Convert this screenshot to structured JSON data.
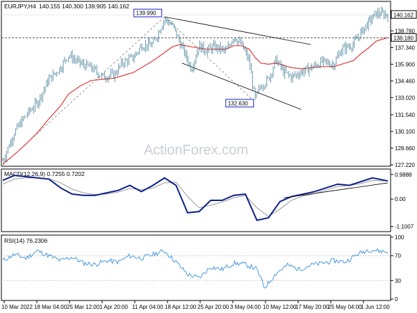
{
  "header": {
    "symbol": "EURJPY,H4",
    "ohlc": "140.155 140.300 139.905 140.162"
  },
  "watermark": "ActionForex.com",
  "colors": {
    "candle": "#2f6f8a",
    "ma": "#e03a3a",
    "trend": "#000000",
    "macd_hist": "#0b1f8a",
    "macd_signal": "#9a9a9a",
    "rsi": "#3a8fd8",
    "label_border": "#1a1ad0",
    "grid": "#c8c8c8"
  },
  "chart_data": [
    {
      "type": "line",
      "name": "price",
      "title": "EURJPY,H4",
      "ylim": [
        127.22,
        141.2
      ],
      "y_ticks": [
        127.22,
        128.66,
        130.1,
        131.54,
        133.02,
        134.46,
        135.9,
        137.34,
        138.78
      ],
      "y_tick_labels": [
        "127.220",
        "128.660",
        "130.100",
        "131.540",
        "133.020",
        "134.460",
        "135.900",
        "137.340",
        "138.780"
      ],
      "x_ticks": [
        "10 Mar 2022",
        "18 Mar 04:00",
        "25 Mar 12:00",
        "1 Apr 20:00",
        "11 Apr 04:00",
        "18 Apr 12:00",
        "25 Apr 20:00",
        "3 May 04:00",
        "10 May 12:00",
        "17 May 20:00",
        "25 May 04:00",
        "1 Jun 12:00"
      ],
      "current_price": 140.162,
      "current_price_label": "140.162",
      "hline": 138.18,
      "hline_label": "138.180",
      "annotations": [
        {
          "text": "139.990",
          "x": 0.42,
          "y": 139.99
        },
        {
          "text": "132.630",
          "x": 0.655,
          "y": 132.63
        }
      ],
      "x": [
        0,
        0.03,
        0.06,
        0.09,
        0.12,
        0.15,
        0.17,
        0.2,
        0.23,
        0.26,
        0.29,
        0.31,
        0.34,
        0.36,
        0.39,
        0.42,
        0.44,
        0.46,
        0.49,
        0.51,
        0.53,
        0.55,
        0.58,
        0.6,
        0.62,
        0.64,
        0.655,
        0.67,
        0.69,
        0.71,
        0.73,
        0.75,
        0.78,
        0.8,
        0.83,
        0.86,
        0.88,
        0.91,
        0.93,
        0.95,
        0.97,
        1.0
      ],
      "values": [
        127.6,
        130.0,
        131.5,
        132.6,
        134.6,
        135.6,
        136.7,
        136.0,
        135.6,
        134.8,
        135.0,
        136.0,
        136.5,
        137.5,
        137.6,
        139.8,
        139.3,
        137.8,
        135.5,
        137.5,
        137.1,
        137.4,
        137.0,
        138.3,
        137.6,
        136.2,
        132.8,
        134.0,
        134.6,
        136.3,
        135.2,
        134.8,
        135.3,
        135.6,
        136.1,
        135.9,
        137.2,
        137.6,
        138.6,
        139.5,
        140.3,
        140.16
      ],
      "ma_values": [
        127.3,
        128.1,
        129.0,
        130.0,
        131.2,
        132.3,
        133.3,
        134.0,
        134.5,
        134.6,
        134.7,
        134.9,
        135.2,
        135.6,
        136.2,
        136.9,
        137.4,
        137.6,
        137.4,
        137.3,
        137.2,
        137.2,
        137.2,
        137.5,
        137.5,
        137.2,
        136.5,
        136.0,
        135.9,
        136.0,
        135.8,
        135.6,
        135.5,
        135.6,
        135.7,
        135.7,
        135.9,
        136.2,
        136.8,
        137.3,
        137.9,
        138.2
      ]
    },
    {
      "type": "line",
      "name": "macd",
      "title": "MACD(12,26,9) 0.7255 0.7202",
      "ylim": [
        -1.25,
        1.15
      ],
      "y_ticks": [
        0.9888,
        0.0,
        -1.1007
      ],
      "y_tick_labels": [
        "0.9888",
        "0.00",
        "-1.1007"
      ],
      "x": [
        0,
        0.03,
        0.06,
        0.09,
        0.12,
        0.15,
        0.18,
        0.21,
        0.24,
        0.27,
        0.3,
        0.33,
        0.36,
        0.39,
        0.42,
        0.45,
        0.48,
        0.51,
        0.54,
        0.57,
        0.6,
        0.63,
        0.66,
        0.69,
        0.72,
        0.75,
        0.78,
        0.81,
        0.84,
        0.87,
        0.9,
        0.93,
        0.96,
        1.0
      ],
      "values": [
        0.75,
        0.95,
        0.9,
        0.85,
        0.8,
        0.45,
        0.2,
        0.15,
        0.15,
        0.25,
        0.35,
        0.55,
        0.3,
        0.55,
        0.85,
        0.55,
        -0.55,
        -0.5,
        -0.05,
        -0.05,
        0.15,
        0.2,
        -0.85,
        -0.75,
        -0.1,
        0.1,
        0.2,
        0.3,
        0.45,
        0.6,
        0.55,
        0.7,
        0.85,
        0.73
      ],
      "signal_values": [
        0.6,
        0.8,
        0.85,
        0.85,
        0.82,
        0.65,
        0.4,
        0.25,
        0.18,
        0.2,
        0.28,
        0.42,
        0.38,
        0.45,
        0.65,
        0.68,
        0.1,
        -0.35,
        -0.25,
        -0.12,
        0.05,
        0.15,
        -0.35,
        -0.7,
        -0.4,
        -0.05,
        0.12,
        0.22,
        0.36,
        0.5,
        0.55,
        0.62,
        0.75,
        0.72
      ],
      "trendline": [
        [
          0.73,
          0.05
        ],
        [
          1.0,
          0.65
        ]
      ]
    },
    {
      "type": "line",
      "name": "rsi",
      "title": "RSI(14) 76.2306",
      "ylim": [
        0,
        100
      ],
      "y_ticks": [
        100,
        70,
        30,
        0
      ],
      "y_tick_labels": [
        "100",
        "70",
        "30",
        "0"
      ],
      "x": [
        0,
        0.03,
        0.06,
        0.09,
        0.12,
        0.15,
        0.18,
        0.21,
        0.24,
        0.27,
        0.3,
        0.33,
        0.36,
        0.39,
        0.42,
        0.45,
        0.48,
        0.51,
        0.54,
        0.57,
        0.6,
        0.63,
        0.66,
        0.68,
        0.71,
        0.74,
        0.77,
        0.8,
        0.83,
        0.86,
        0.89,
        0.92,
        0.95,
        1.0
      ],
      "values": [
        62,
        72,
        66,
        78,
        70,
        62,
        68,
        58,
        56,
        62,
        60,
        70,
        66,
        72,
        78,
        60,
        40,
        34,
        52,
        48,
        58,
        56,
        48,
        18,
        42,
        55,
        48,
        55,
        58,
        62,
        60,
        72,
        80,
        76
      ]
    }
  ]
}
